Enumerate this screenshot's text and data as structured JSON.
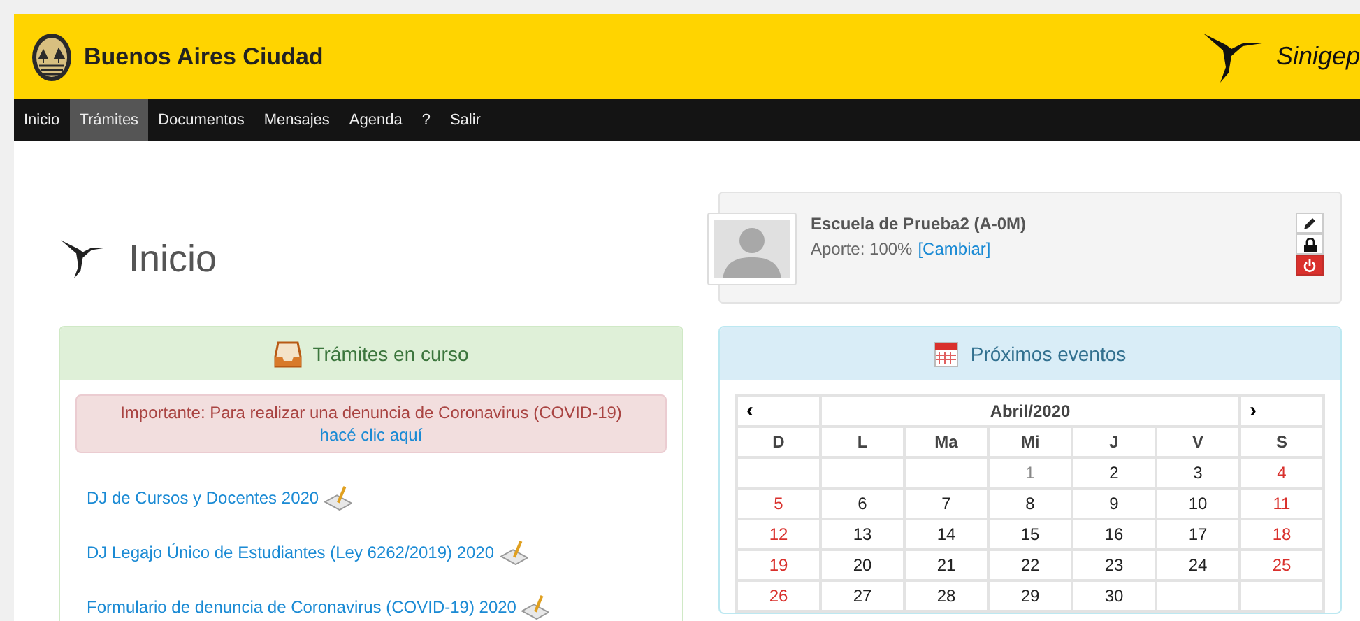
{
  "header": {
    "brand": "Buenos Aires Ciudad",
    "app_name": "Sinigep"
  },
  "nav": [
    {
      "label": "Inicio",
      "selected": false
    },
    {
      "label": "Trámites",
      "selected": true
    },
    {
      "label": "Documentos",
      "selected": false
    },
    {
      "label": "Mensajes",
      "selected": false
    },
    {
      "label": "Agenda",
      "selected": false
    },
    {
      "label": "?",
      "selected": false
    },
    {
      "label": "Salir",
      "selected": false
    }
  ],
  "page_title": "Inicio",
  "profile": {
    "name": "Escuela de Prueba2 (A-0M)",
    "aporte": "Aporte: 100%",
    "change_link": "[Cambiar]"
  },
  "tramites": {
    "title": "Trámites en curso",
    "alert": "Importante: Para realizar una denuncia de Coronavirus (COVID-19)",
    "alert_link": "hacé clic aquí",
    "items": [
      "DJ de Cursos y Docentes 2020",
      "DJ Legajo Único de Estudiantes (Ley 6262/2019) 2020",
      "Formulario de denuncia de Coronavirus (COVID-19) 2020"
    ]
  },
  "eventos": {
    "title": "Próximos eventos",
    "prev": "‹",
    "next": "›",
    "month": "Abril/2020",
    "weekdays": [
      "D",
      "L",
      "Ma",
      "Mi",
      "J",
      "V",
      "S"
    ],
    "days": [
      {
        "kind": "empty"
      },
      {
        "kind": "empty"
      },
      {
        "kind": "empty"
      },
      {
        "day": "1",
        "kind": "dim"
      },
      {
        "day": "2",
        "kind": "weekday"
      },
      {
        "day": "3",
        "kind": "weekday"
      },
      {
        "day": "4",
        "kind": "weekend"
      },
      {
        "day": "5",
        "kind": "weekend"
      },
      {
        "day": "6",
        "kind": "weekday"
      },
      {
        "day": "7",
        "kind": "weekday"
      },
      {
        "day": "8",
        "kind": "weekday"
      },
      {
        "day": "9",
        "kind": "weekday"
      },
      {
        "day": "10",
        "kind": "weekday"
      },
      {
        "day": "11",
        "kind": "weekend"
      },
      {
        "day": "12",
        "kind": "weekend"
      },
      {
        "day": "13",
        "kind": "weekday"
      },
      {
        "day": "14",
        "kind": "weekday"
      },
      {
        "day": "15",
        "kind": "weekday"
      },
      {
        "day": "16",
        "kind": "weekday"
      },
      {
        "day": "17",
        "kind": "weekday"
      },
      {
        "day": "18",
        "kind": "weekend"
      },
      {
        "day": "19",
        "kind": "weekend"
      },
      {
        "day": "20",
        "kind": "weekday"
      },
      {
        "day": "21",
        "kind": "weekday"
      },
      {
        "day": "22",
        "kind": "weekday"
      },
      {
        "day": "23",
        "kind": "weekday"
      },
      {
        "day": "24",
        "kind": "weekday"
      },
      {
        "day": "25",
        "kind": "weekend"
      },
      {
        "day": "26",
        "kind": "weekend"
      },
      {
        "day": "27",
        "kind": "weekday"
      },
      {
        "day": "28",
        "kind": "weekday"
      },
      {
        "day": "29",
        "kind": "weekday"
      },
      {
        "day": "30",
        "kind": "weekday"
      },
      {
        "kind": "empty"
      },
      {
        "kind": "empty"
      }
    ]
  }
}
